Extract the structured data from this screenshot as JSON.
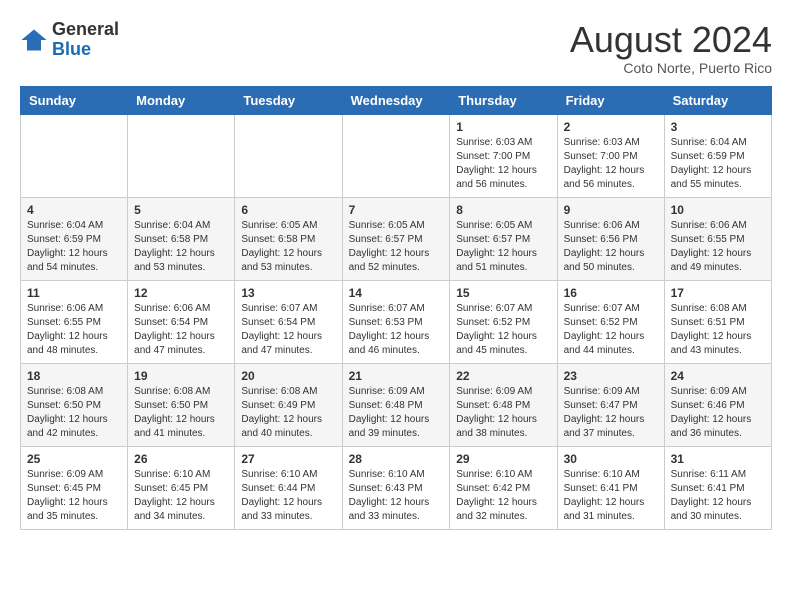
{
  "header": {
    "logo_line1": "General",
    "logo_line2": "Blue",
    "month_title": "August 2024",
    "location": "Coto Norte, Puerto Rico"
  },
  "weekdays": [
    "Sunday",
    "Monday",
    "Tuesday",
    "Wednesday",
    "Thursday",
    "Friday",
    "Saturday"
  ],
  "weeks": [
    [
      {
        "day": "",
        "info": ""
      },
      {
        "day": "",
        "info": ""
      },
      {
        "day": "",
        "info": ""
      },
      {
        "day": "",
        "info": ""
      },
      {
        "day": "1",
        "info": "Sunrise: 6:03 AM\nSunset: 7:00 PM\nDaylight: 12 hours\nand 56 minutes."
      },
      {
        "day": "2",
        "info": "Sunrise: 6:03 AM\nSunset: 7:00 PM\nDaylight: 12 hours\nand 56 minutes."
      },
      {
        "day": "3",
        "info": "Sunrise: 6:04 AM\nSunset: 6:59 PM\nDaylight: 12 hours\nand 55 minutes."
      }
    ],
    [
      {
        "day": "4",
        "info": "Sunrise: 6:04 AM\nSunset: 6:59 PM\nDaylight: 12 hours\nand 54 minutes."
      },
      {
        "day": "5",
        "info": "Sunrise: 6:04 AM\nSunset: 6:58 PM\nDaylight: 12 hours\nand 53 minutes."
      },
      {
        "day": "6",
        "info": "Sunrise: 6:05 AM\nSunset: 6:58 PM\nDaylight: 12 hours\nand 53 minutes."
      },
      {
        "day": "7",
        "info": "Sunrise: 6:05 AM\nSunset: 6:57 PM\nDaylight: 12 hours\nand 52 minutes."
      },
      {
        "day": "8",
        "info": "Sunrise: 6:05 AM\nSunset: 6:57 PM\nDaylight: 12 hours\nand 51 minutes."
      },
      {
        "day": "9",
        "info": "Sunrise: 6:06 AM\nSunset: 6:56 PM\nDaylight: 12 hours\nand 50 minutes."
      },
      {
        "day": "10",
        "info": "Sunrise: 6:06 AM\nSunset: 6:55 PM\nDaylight: 12 hours\nand 49 minutes."
      }
    ],
    [
      {
        "day": "11",
        "info": "Sunrise: 6:06 AM\nSunset: 6:55 PM\nDaylight: 12 hours\nand 48 minutes."
      },
      {
        "day": "12",
        "info": "Sunrise: 6:06 AM\nSunset: 6:54 PM\nDaylight: 12 hours\nand 47 minutes."
      },
      {
        "day": "13",
        "info": "Sunrise: 6:07 AM\nSunset: 6:54 PM\nDaylight: 12 hours\nand 47 minutes."
      },
      {
        "day": "14",
        "info": "Sunrise: 6:07 AM\nSunset: 6:53 PM\nDaylight: 12 hours\nand 46 minutes."
      },
      {
        "day": "15",
        "info": "Sunrise: 6:07 AM\nSunset: 6:52 PM\nDaylight: 12 hours\nand 45 minutes."
      },
      {
        "day": "16",
        "info": "Sunrise: 6:07 AM\nSunset: 6:52 PM\nDaylight: 12 hours\nand 44 minutes."
      },
      {
        "day": "17",
        "info": "Sunrise: 6:08 AM\nSunset: 6:51 PM\nDaylight: 12 hours\nand 43 minutes."
      }
    ],
    [
      {
        "day": "18",
        "info": "Sunrise: 6:08 AM\nSunset: 6:50 PM\nDaylight: 12 hours\nand 42 minutes."
      },
      {
        "day": "19",
        "info": "Sunrise: 6:08 AM\nSunset: 6:50 PM\nDaylight: 12 hours\nand 41 minutes."
      },
      {
        "day": "20",
        "info": "Sunrise: 6:08 AM\nSunset: 6:49 PM\nDaylight: 12 hours\nand 40 minutes."
      },
      {
        "day": "21",
        "info": "Sunrise: 6:09 AM\nSunset: 6:48 PM\nDaylight: 12 hours\nand 39 minutes."
      },
      {
        "day": "22",
        "info": "Sunrise: 6:09 AM\nSunset: 6:48 PM\nDaylight: 12 hours\nand 38 minutes."
      },
      {
        "day": "23",
        "info": "Sunrise: 6:09 AM\nSunset: 6:47 PM\nDaylight: 12 hours\nand 37 minutes."
      },
      {
        "day": "24",
        "info": "Sunrise: 6:09 AM\nSunset: 6:46 PM\nDaylight: 12 hours\nand 36 minutes."
      }
    ],
    [
      {
        "day": "25",
        "info": "Sunrise: 6:09 AM\nSunset: 6:45 PM\nDaylight: 12 hours\nand 35 minutes."
      },
      {
        "day": "26",
        "info": "Sunrise: 6:10 AM\nSunset: 6:45 PM\nDaylight: 12 hours\nand 34 minutes."
      },
      {
        "day": "27",
        "info": "Sunrise: 6:10 AM\nSunset: 6:44 PM\nDaylight: 12 hours\nand 33 minutes."
      },
      {
        "day": "28",
        "info": "Sunrise: 6:10 AM\nSunset: 6:43 PM\nDaylight: 12 hours\nand 33 minutes."
      },
      {
        "day": "29",
        "info": "Sunrise: 6:10 AM\nSunset: 6:42 PM\nDaylight: 12 hours\nand 32 minutes."
      },
      {
        "day": "30",
        "info": "Sunrise: 6:10 AM\nSunset: 6:41 PM\nDaylight: 12 hours\nand 31 minutes."
      },
      {
        "day": "31",
        "info": "Sunrise: 6:11 AM\nSunset: 6:41 PM\nDaylight: 12 hours\nand 30 minutes."
      }
    ]
  ]
}
